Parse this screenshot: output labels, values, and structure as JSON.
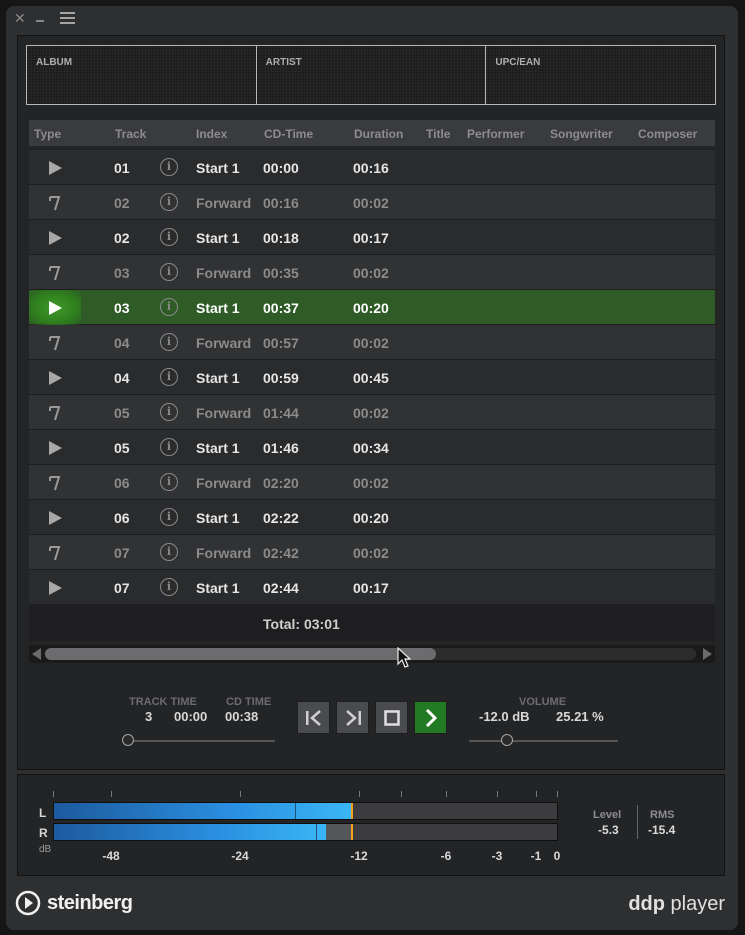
{
  "window": {
    "close_label": "✕",
    "minimize_label": "",
    "menu_label": ""
  },
  "info": {
    "album_label": "ALBUM",
    "artist_label": "ARTIST",
    "upc_label": "UPC/EAN"
  },
  "columns": {
    "type": "Type",
    "track": "Track",
    "index": "Index",
    "cdtime": "CD-Time",
    "duration": "Duration",
    "title": "Title",
    "performer": "Performer",
    "songwriter": "Songwriter",
    "composer": "Composer"
  },
  "rows": [
    {
      "kind": "start",
      "track": "01",
      "index": "Start 1",
      "cdtime": "00:00",
      "duration": "00:16"
    },
    {
      "kind": "forward",
      "track": "02",
      "index": "Forward",
      "cdtime": "00:16",
      "duration": "00:02"
    },
    {
      "kind": "start",
      "track": "02",
      "index": "Start 1",
      "cdtime": "00:18",
      "duration": "00:17"
    },
    {
      "kind": "forward",
      "track": "03",
      "index": "Forward",
      "cdtime": "00:35",
      "duration": "00:02"
    },
    {
      "kind": "start",
      "track": "03",
      "index": "Start 1",
      "cdtime": "00:37",
      "duration": "00:20",
      "selected": true
    },
    {
      "kind": "forward",
      "track": "04",
      "index": "Forward",
      "cdtime": "00:57",
      "duration": "00:02"
    },
    {
      "kind": "start",
      "track": "04",
      "index": "Start 1",
      "cdtime": "00:59",
      "duration": "00:45"
    },
    {
      "kind": "forward",
      "track": "05",
      "index": "Forward",
      "cdtime": "01:44",
      "duration": "00:02"
    },
    {
      "kind": "start",
      "track": "05",
      "index": "Start 1",
      "cdtime": "01:46",
      "duration": "00:34"
    },
    {
      "kind": "forward",
      "track": "06",
      "index": "Forward",
      "cdtime": "02:20",
      "duration": "00:02"
    },
    {
      "kind": "start",
      "track": "06",
      "index": "Start 1",
      "cdtime": "02:22",
      "duration": "00:20"
    },
    {
      "kind": "forward",
      "track": "07",
      "index": "Forward",
      "cdtime": "02:42",
      "duration": "00:02"
    },
    {
      "kind": "start",
      "track": "07",
      "index": "Start 1",
      "cdtime": "02:44",
      "duration": "00:17"
    }
  ],
  "info_glyph": "i",
  "total": "Total: 03:01",
  "scrollbar": {
    "position": 0.6
  },
  "transport": {
    "track_time_label": "TRACK TIME",
    "track_number": "3",
    "track_time": "00:00",
    "cd_time_label": "CD TIME",
    "cd_time": "00:38",
    "position_slider": 0.0,
    "volume_label": "VOLUME",
    "volume_db": "-12.0 dB",
    "volume_pct": "25.21 %",
    "volume_slider": 0.2521
  },
  "meter": {
    "left_label": "L",
    "right_label": "R",
    "unit_label": "dB",
    "scale": [
      "-48",
      "-24",
      "-12",
      "-6",
      "-3",
      "-1",
      "0"
    ],
    "left": {
      "rms": 0.48,
      "level": 0.59,
      "hold": 0.59
    },
    "right": {
      "rms": 0.52,
      "level": 0.54,
      "hold": 0.59
    },
    "level_label": "Level",
    "level_value": "-5.3",
    "rms_label": "RMS",
    "rms_value": "-15.4"
  },
  "footer": {
    "brand": "steinberg",
    "product_bold": "ddp",
    "product_light": " player"
  },
  "colors": {
    "accent_green": "#237a25",
    "selected_row": "#2e5b26",
    "meter_blue": "#2a8fe0",
    "peak_hold": "#f2a21b"
  }
}
